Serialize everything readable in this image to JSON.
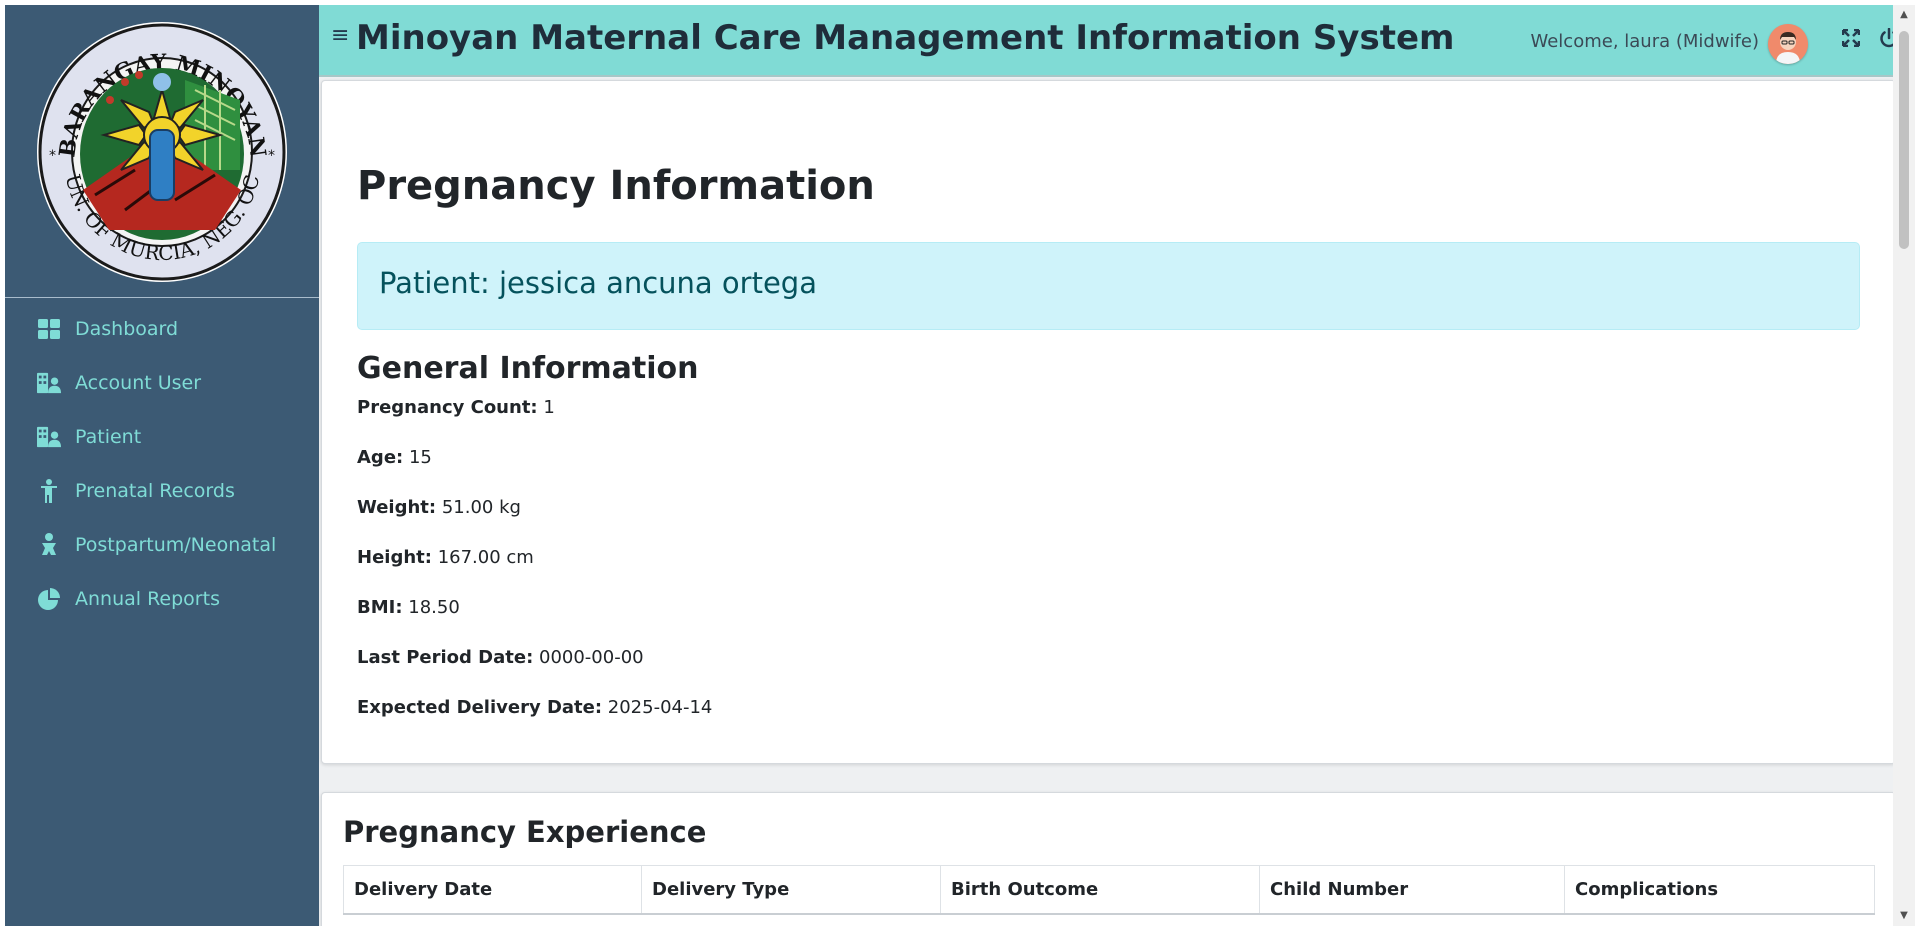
{
  "logo": {
    "seal_text_top": "BARANGAY MINOYAN",
    "seal_text_bottom": "MUN. OF MURCIA, NEG. OCC."
  },
  "sidebar": {
    "items": [
      {
        "label": "Dashboard",
        "icon": "dashboard-icon"
      },
      {
        "label": "Account User",
        "icon": "users-icon"
      },
      {
        "label": "Patient",
        "icon": "patients-icon"
      },
      {
        "label": "Prenatal Records",
        "icon": "prenatal-icon"
      },
      {
        "label": "Postpartum/Neonatal",
        "icon": "postpartum-icon"
      },
      {
        "label": "Annual Reports",
        "icon": "pie-chart-icon"
      }
    ]
  },
  "header": {
    "title": "Minoyan Maternal Care Management Information System",
    "welcome": "Welcome, laura (Midwife)"
  },
  "page": {
    "title": "Pregnancy Information",
    "patient": "Patient: jessica ancuna ortega",
    "general_title": "General Information",
    "fields": [
      {
        "label": "Pregnancy Count:",
        "value": "1"
      },
      {
        "label": "Age:",
        "value": "15"
      },
      {
        "label": "Weight:",
        "value": "51.00 kg"
      },
      {
        "label": "Height:",
        "value": "167.00 cm"
      },
      {
        "label": "BMI:",
        "value": "18.50"
      },
      {
        "label": "Last Period Date:",
        "value": "0000-00-00"
      },
      {
        "label": "Expected Delivery Date:",
        "value": "2025-04-14"
      }
    ]
  },
  "experience": {
    "title": "Pregnancy Experience",
    "columns": [
      "Delivery Date",
      "Delivery Type",
      "Birth Outcome",
      "Child Number",
      "Complications"
    ]
  },
  "colors": {
    "sidebar_bg": "#3c5a74",
    "header_bg": "#80dbd5",
    "nav_text": "#7fdcd6",
    "patient_box_bg": "#cff3fa"
  }
}
